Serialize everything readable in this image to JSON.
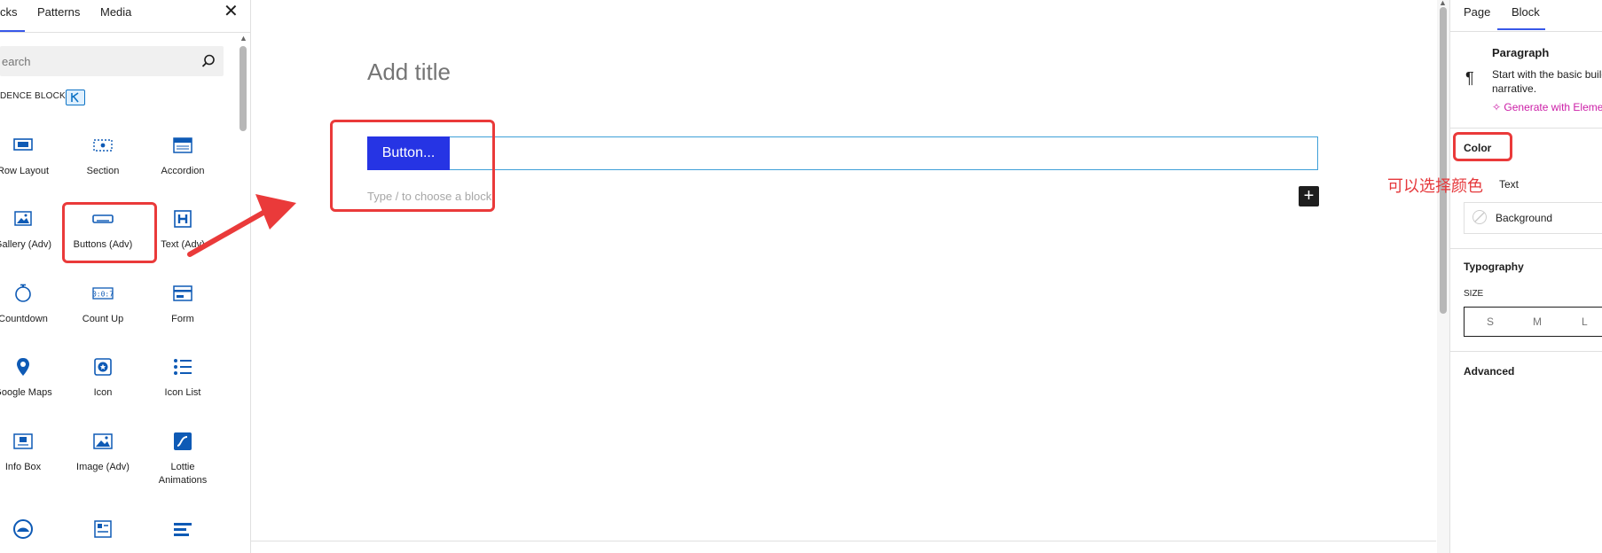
{
  "inserter": {
    "tabs": [
      "cks",
      "Patterns",
      "Media"
    ],
    "close_symbol": "✕",
    "search_placeholder": "earch",
    "category_label": "DENCE BLOCKS",
    "blocks": [
      {
        "label": "Row Layout",
        "icon": "row-layout-icon"
      },
      {
        "label": "Section",
        "icon": "section-icon"
      },
      {
        "label": "Accordion",
        "icon": "accordion-icon"
      },
      {
        "label": "Gallery (Adv)",
        "icon": "gallery-icon"
      },
      {
        "label": "Buttons (Adv)",
        "icon": "buttons-icon"
      },
      {
        "label": "Text (Adv)",
        "icon": "text-h-icon"
      },
      {
        "label": "Countdown",
        "icon": "countdown-icon"
      },
      {
        "label": "Count Up",
        "icon": "count-up-icon"
      },
      {
        "label": "Form",
        "icon": "form-icon"
      },
      {
        "label": "Google Maps",
        "icon": "map-pin-icon"
      },
      {
        "label": "Icon",
        "icon": "star-icon"
      },
      {
        "label": "Icon List",
        "icon": "icon-list-icon"
      },
      {
        "label": "Info Box",
        "icon": "info-box-icon"
      },
      {
        "label": "Image (Adv)",
        "icon": "image-icon"
      },
      {
        "label": "Lottie\nAnimations",
        "icon": "lottie-icon"
      }
    ]
  },
  "editor": {
    "title_placeholder": "Add title",
    "button_text": "Button...",
    "block_placeholder": "Type / to choose a block",
    "add_symbol": "+"
  },
  "sidebar": {
    "tabs": [
      "Page",
      "Block"
    ],
    "block_name": "Paragraph",
    "block_description": "Start with the basic build all narrative.",
    "generate_link": "Generate with Eleme",
    "color_section": "Color",
    "color_text": "Text",
    "color_background": "Background",
    "typography_section": "Typography",
    "size_label": "SIZE",
    "sizes": [
      "S",
      "M",
      "L"
    ],
    "advanced_section": "Advanced"
  },
  "annotation": {
    "text": "可以选择颜色",
    "color": "#e5383b"
  },
  "colors": {
    "accent": "#3858e9",
    "button_bg": "#2634e4",
    "block_icon": "#0e5ab5",
    "annotation_red": "#ea3a3a"
  }
}
